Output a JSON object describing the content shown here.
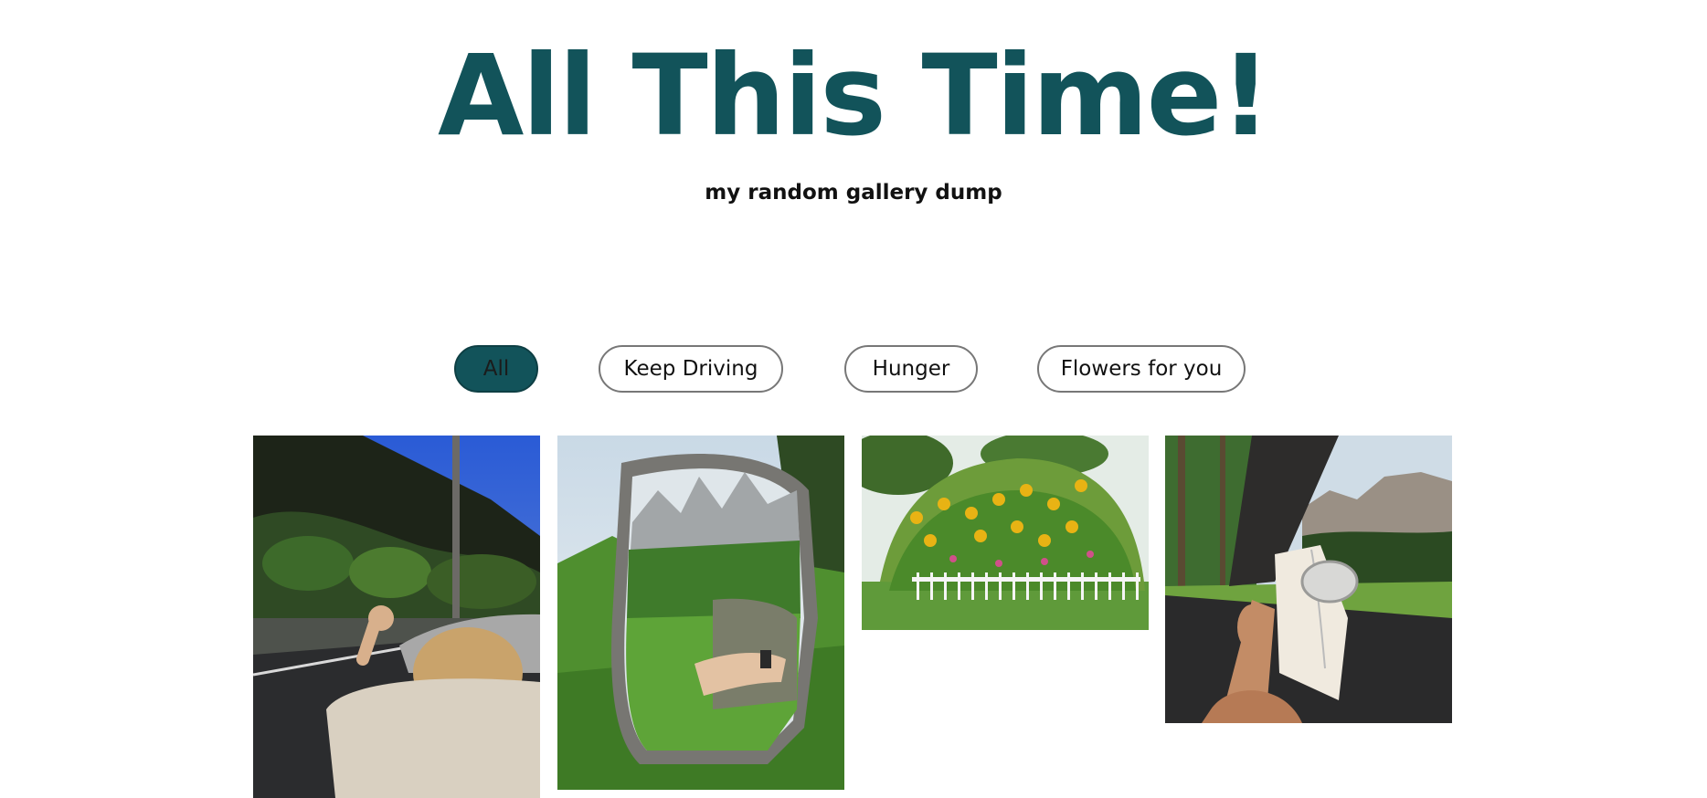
{
  "header": {
    "title": "All This Time!",
    "subtitle": "my random gallery dump"
  },
  "filters": [
    {
      "label": "All",
      "active": true
    },
    {
      "label": "Keep Driving",
      "active": false
    },
    {
      "label": "Hunger",
      "active": false
    },
    {
      "label": "Flowers for you",
      "active": false
    }
  ],
  "colors": {
    "brand": "#12535a",
    "text": "#111111"
  },
  "gallery": {
    "images": [
      {
        "name": "convertible-drive-photo",
        "category": "Keep Driving"
      },
      {
        "name": "side-mirror-mountains-photo",
        "category": "Keep Driving"
      },
      {
        "name": "sunflower-garden-photo",
        "category": "Flowers for you"
      },
      {
        "name": "reading-in-car-photo",
        "category": "Keep Driving"
      }
    ]
  }
}
